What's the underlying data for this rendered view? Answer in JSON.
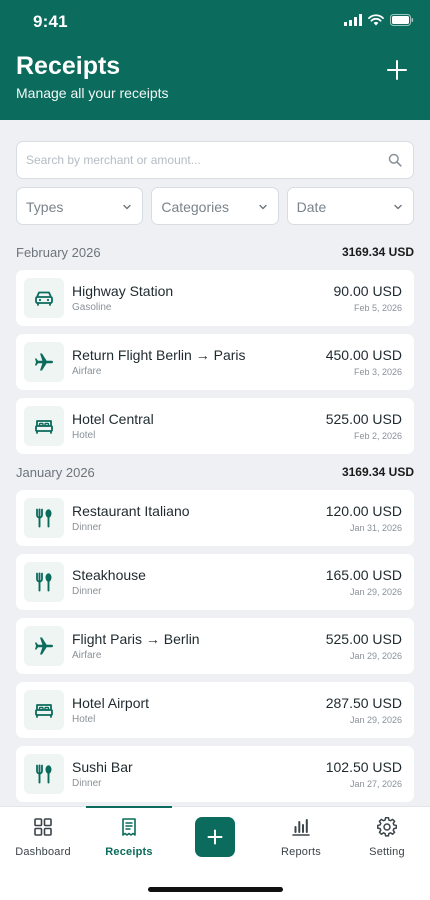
{
  "status": {
    "time": "9:41"
  },
  "header": {
    "title": "Receipts",
    "subtitle": "Manage all your receipts",
    "add_icon": "plus-icon"
  },
  "search": {
    "placeholder": "Search by merchant or amount...",
    "icon": "search-icon"
  },
  "filters": [
    {
      "label": "Types"
    },
    {
      "label": "Categories"
    },
    {
      "label": "Date"
    }
  ],
  "sections": [
    {
      "month": "February 2026",
      "total": "3169.34 USD",
      "items": [
        {
          "icon": "car-icon",
          "merchant": "Highway Station",
          "category": "Gasoline",
          "amount": "90.00 USD",
          "date": "Feb 5, 2026"
        },
        {
          "icon": "airplane-icon",
          "merchant": "Return Flight Berlin → Paris",
          "category": "Airfare",
          "amount": "450.00 USD",
          "date": "Feb 3, 2026"
        },
        {
          "icon": "bed-icon",
          "merchant": "Hotel Central",
          "category": "Hotel",
          "amount": "525.00 USD",
          "date": "Feb 2, 2026"
        }
      ]
    },
    {
      "month": "January 2026",
      "total": "3169.34 USD",
      "items": [
        {
          "icon": "fork-spoon-icon",
          "merchant": "Restaurant Italiano",
          "category": "Dinner",
          "amount": "120.00 USD",
          "date": "Jan 31, 2026"
        },
        {
          "icon": "fork-spoon-icon",
          "merchant": "Steakhouse",
          "category": "Dinner",
          "amount": "165.00 USD",
          "date": "Jan 29, 2026"
        },
        {
          "icon": "airplane-icon",
          "merchant": "Flight Paris → Berlin",
          "category": "Airfare",
          "amount": "525.00 USD",
          "date": "Jan 29, 2026"
        },
        {
          "icon": "bed-icon",
          "merchant": "Hotel Airport",
          "category": "Hotel",
          "amount": "287.50 USD",
          "date": "Jan 29, 2026"
        },
        {
          "icon": "fork-spoon-icon",
          "merchant": "Sushi Bar",
          "category": "Dinner",
          "amount": "102.50 USD",
          "date": "Jan 27, 2026"
        }
      ]
    }
  ],
  "tabbar": {
    "active": "Receipts",
    "tabs": [
      {
        "label": "Dashboard",
        "icon": "grid-icon"
      },
      {
        "label": "Receipts",
        "icon": "receipt-icon"
      },
      {
        "label": "",
        "icon": "plus-icon"
      },
      {
        "label": "Reports",
        "icon": "bar-chart-icon"
      },
      {
        "label": "Setting",
        "icon": "gear-icon"
      }
    ]
  },
  "colors": {
    "brand": "#0b6b5c",
    "background": "#eef0f4",
    "card": "#ffffff"
  }
}
